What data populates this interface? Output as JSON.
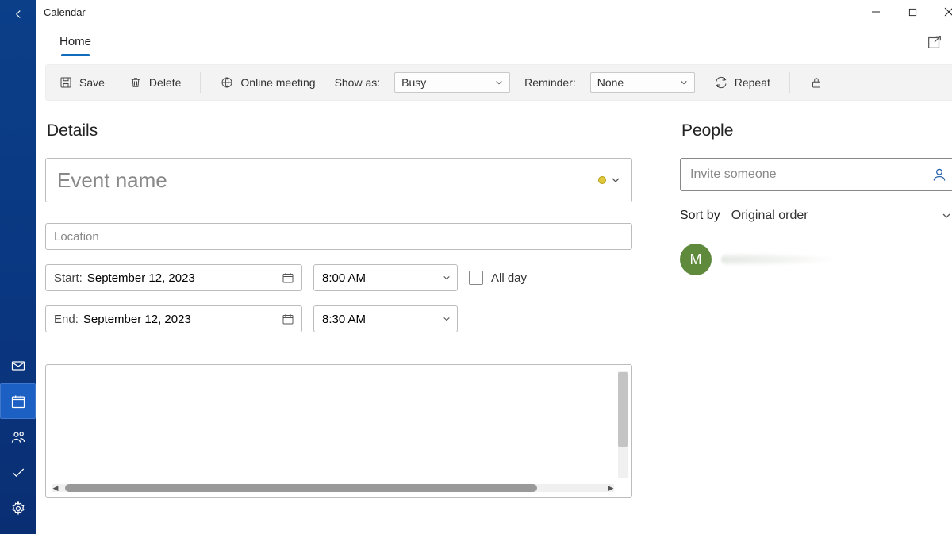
{
  "window": {
    "title": "Calendar"
  },
  "tabs": {
    "home": "Home"
  },
  "ribbon": {
    "save": "Save",
    "delete": "Delete",
    "online_meeting": "Online meeting",
    "show_as_label": "Show as:",
    "show_as_value": "Busy",
    "reminder_label": "Reminder:",
    "reminder_value": "None",
    "repeat": "Repeat"
  },
  "details": {
    "heading": "Details",
    "event_name_placeholder": "Event name",
    "event_name_value": "",
    "location_placeholder": "Location",
    "location_value": "",
    "start_label": "Start:",
    "start_date": "September 12, 2023",
    "start_time": "8:00 AM",
    "end_label": "End:",
    "end_date": "September 12, 2023",
    "end_time": "8:30 AM",
    "all_day_label": "All day",
    "description_value": ""
  },
  "people": {
    "heading": "People",
    "invite_placeholder": "Invite someone",
    "sort_label": "Sort by",
    "sort_value": "Original order",
    "attendee_initial": "M"
  }
}
